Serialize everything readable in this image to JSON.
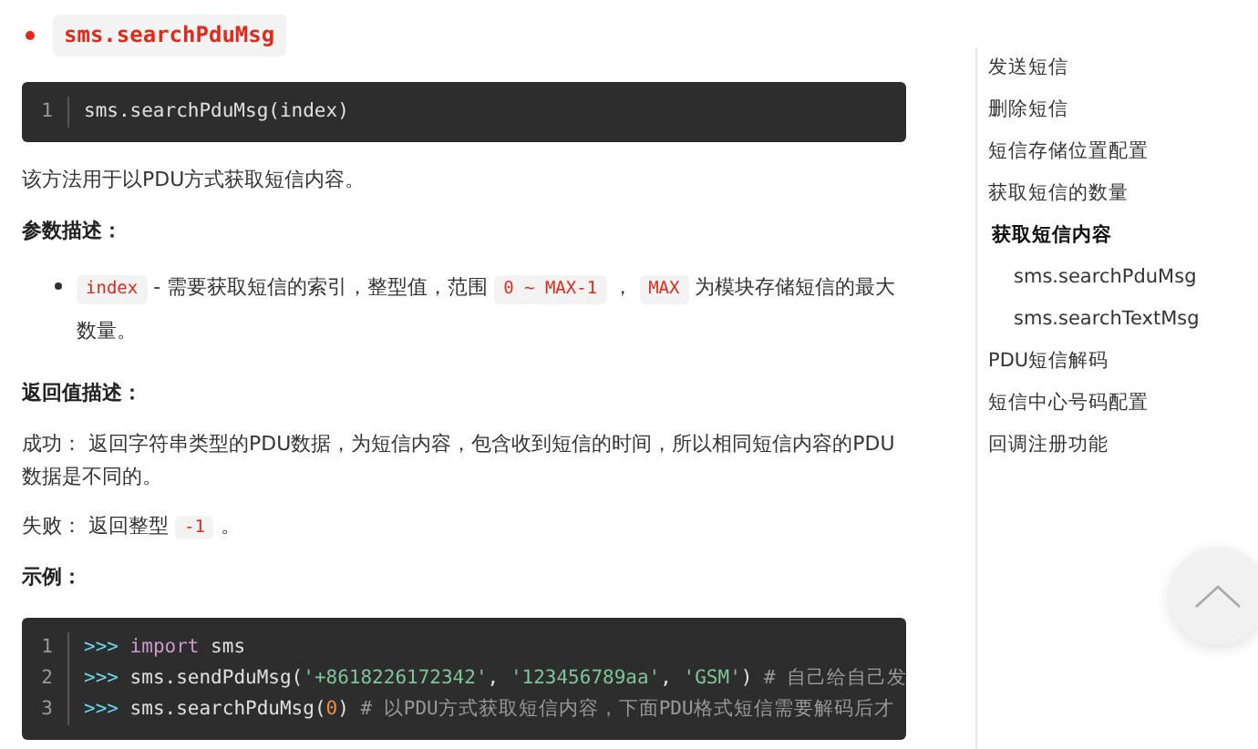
{
  "heading": {
    "code": "sms.searchPduMsg"
  },
  "signature_block": {
    "lines": [
      {
        "number": "1",
        "tokens": [
          {
            "kind": "plain",
            "text": "sms.searchPduMsg(index)"
          }
        ]
      }
    ]
  },
  "description": "该方法用于以PDU方式获取短信内容。",
  "params_title": "参数描述：",
  "params": [
    {
      "segments": [
        {
          "kind": "code",
          "text": "index"
        },
        {
          "kind": "text",
          "text": " - 需要获取短信的索引，整型值，范围 "
        },
        {
          "kind": "code",
          "text": "0 ~ MAX-1"
        },
        {
          "kind": "text",
          "text": " ， "
        },
        {
          "kind": "code",
          "text": "MAX"
        },
        {
          "kind": "text",
          "text": " 为模块存储短信的最大数量。"
        }
      ]
    }
  ],
  "returns_title": "返回值描述：",
  "returns": [
    {
      "segments": [
        {
          "kind": "text",
          "text": "成功： 返回字符串类型的PDU数据，为短信内容，包含收到短信的时间，所以相同短信内容的PDU数据是不同的。"
        }
      ]
    },
    {
      "segments": [
        {
          "kind": "text",
          "text": "失败： 返回整型 "
        },
        {
          "kind": "code",
          "text": "-1"
        },
        {
          "kind": "text",
          "text": " 。"
        }
      ]
    }
  ],
  "example_title": "示例：",
  "example_block": {
    "lines": [
      {
        "number": "1",
        "tokens": [
          {
            "kind": "prompt",
            "text": ">>> "
          },
          {
            "kind": "keyword",
            "text": "import"
          },
          {
            "kind": "plain",
            "text": " sms"
          }
        ]
      },
      {
        "number": "2",
        "tokens": [
          {
            "kind": "prompt",
            "text": ">>> "
          },
          {
            "kind": "plain",
            "text": "sms.sendPduMsg("
          },
          {
            "kind": "string",
            "text": "'+8618226172342'"
          },
          {
            "kind": "plain",
            "text": ", "
          },
          {
            "kind": "string",
            "text": "'123456789aa'"
          },
          {
            "kind": "plain",
            "text": ", "
          },
          {
            "kind": "string",
            "text": "'GSM'"
          },
          {
            "kind": "plain",
            "text": ") "
          },
          {
            "kind": "comment",
            "text": "# 自己给自己发"
          }
        ]
      },
      {
        "number": "3",
        "tokens": [
          {
            "kind": "prompt",
            "text": ">>> "
          },
          {
            "kind": "plain",
            "text": "sms.searchPduMsg("
          },
          {
            "kind": "number",
            "text": "0"
          },
          {
            "kind": "plain",
            "text": ") "
          },
          {
            "kind": "comment",
            "text": "# 以PDU方式获取短信内容，下面PDU格式短信需要解码后才"
          }
        ]
      }
    ]
  },
  "toc": {
    "items": [
      {
        "label": "发送短信",
        "selected": false
      },
      {
        "label": "删除短信",
        "selected": false
      },
      {
        "label": "短信存储位置配置",
        "selected": false
      },
      {
        "label": "获取短信的数量",
        "selected": false
      },
      {
        "label": "获取短信内容",
        "selected": true,
        "children": [
          {
            "label": "sms.searchPduMsg",
            "selected": false
          },
          {
            "label": "sms.searchTextMsg",
            "selected": false
          }
        ]
      },
      {
        "label": "PDU短信解码",
        "selected": false
      },
      {
        "label": "短信中心号码配置",
        "selected": false
      },
      {
        "label": "回调注册功能",
        "selected": false
      }
    ]
  }
}
